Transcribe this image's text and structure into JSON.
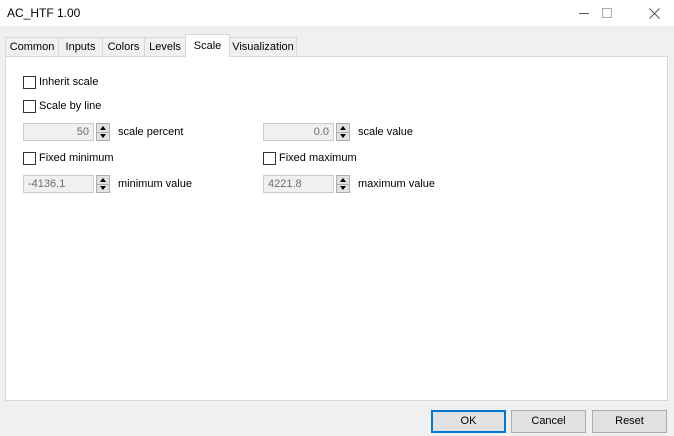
{
  "window": {
    "title": "AC_HTF 1.00"
  },
  "tabs": [
    {
      "label": "Common"
    },
    {
      "label": "Inputs"
    },
    {
      "label": "Colors"
    },
    {
      "label": "Levels"
    },
    {
      "label": "Scale"
    },
    {
      "label": "Visualization"
    }
  ],
  "active_tab": "Scale",
  "scale": {
    "inherit_scale": {
      "label": "Inherit scale",
      "checked": false
    },
    "scale_by_line": {
      "label": "Scale by line",
      "checked": false
    },
    "scale_percent": {
      "value": "50",
      "label": "scale percent"
    },
    "scale_value": {
      "value": "0.0",
      "label": "scale value"
    },
    "fixed_minimum": {
      "label": "Fixed minimum",
      "checked": false
    },
    "fixed_maximum": {
      "label": "Fixed maximum",
      "checked": false
    },
    "minimum_value": {
      "value": "-4136.1",
      "label": "minimum value"
    },
    "maximum_value": {
      "value": "4221.8",
      "label": "maximum value"
    }
  },
  "buttons": {
    "ok": "OK",
    "cancel": "Cancel",
    "reset": "Reset"
  },
  "icons": {
    "minimize": "minimize-icon",
    "maximize": "maximize-icon",
    "close": "close-icon"
  }
}
